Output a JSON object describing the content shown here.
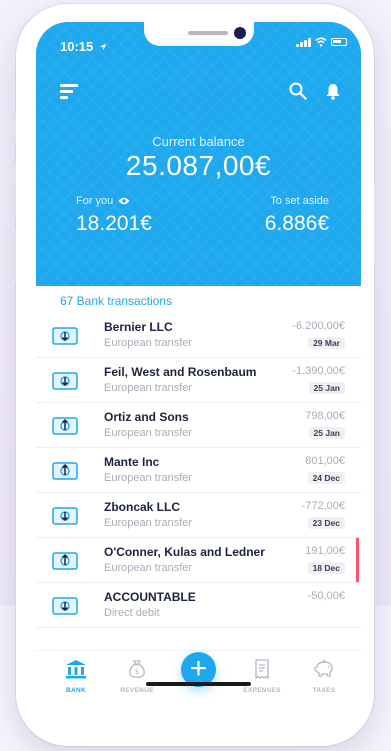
{
  "status_bar": {
    "time": "10:15"
  },
  "header": {
    "menu_icon": "menu-icon",
    "search_icon": "search-icon",
    "bell_icon": "bell-icon",
    "current_balance_label": "Current balance",
    "current_balance_value": "25.087,00€",
    "for_you_label": "For you",
    "for_you_value": "18.201€",
    "to_set_aside_label": "To set aside",
    "to_set_aside_value": "6.886€"
  },
  "transactions": {
    "heading": "67 Bank transactions",
    "items": [
      {
        "name": "Bernier LLC",
        "type": "European transfer",
        "amount": "-6.200,00€",
        "date": "29 Mar",
        "direction": "outgoing"
      },
      {
        "name": "Feil, West and Rosenbaum",
        "type": "European transfer",
        "amount": "-1.390,00€",
        "date": "25 Jan",
        "direction": "outgoing"
      },
      {
        "name": "Ortiz and Sons",
        "type": "European transfer",
        "amount": "798,00€",
        "date": "25 Jan",
        "direction": "incoming"
      },
      {
        "name": "Mante Inc",
        "type": "European transfer",
        "amount": "801,00€",
        "date": "24 Dec",
        "direction": "incoming"
      },
      {
        "name": "Zboncak LLC",
        "type": "European transfer",
        "amount": "-772,00€",
        "date": "23 Dec",
        "direction": "outgoing"
      },
      {
        "name": "O'Conner, Kulas and Ledner",
        "type": "European transfer",
        "amount": "191,00€",
        "date": "18 Dec",
        "direction": "incoming"
      },
      {
        "name": "ACCOUNTABLE",
        "type": "Direct debit",
        "amount": "-50,00€",
        "date": "",
        "direction": "outgoing"
      }
    ]
  },
  "nav": {
    "bank": "BANK",
    "revenue": "REVENUE",
    "expenses": "EXPENSES",
    "taxes": "TAXES",
    "add": "+"
  },
  "colors": {
    "accent": "#1ea8ee",
    "highlight": "#ff5070",
    "text_dark": "#1c2340",
    "text_muted": "#a9adb8"
  }
}
